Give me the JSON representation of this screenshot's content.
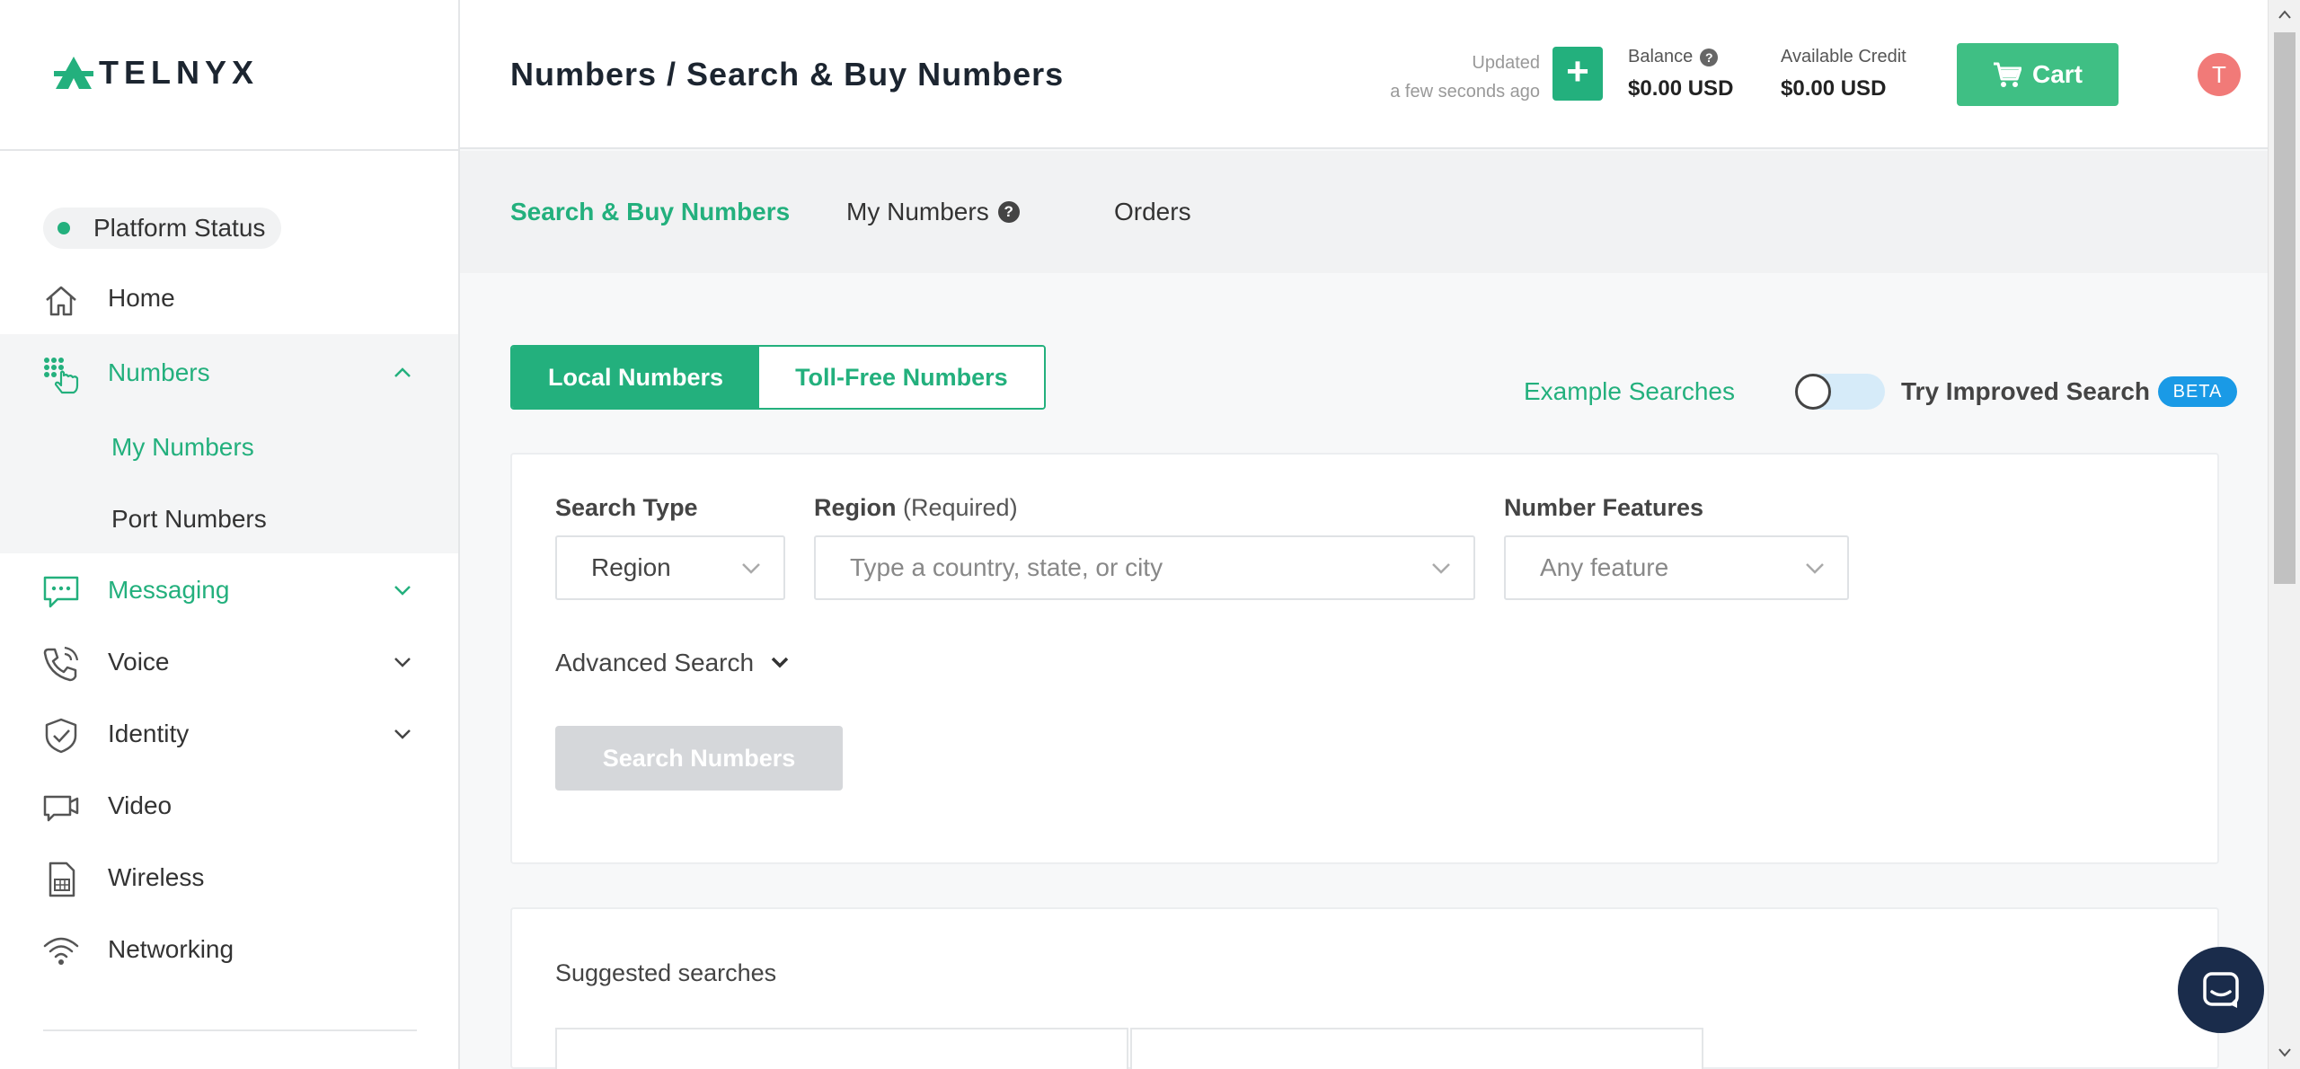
{
  "brand": {
    "name": "TELNYX",
    "accent": "#23b07d"
  },
  "header": {
    "title": "Numbers / Search & Buy Numbers",
    "updated_label": "Updated",
    "updated_time": "a few seconds ago",
    "balance_label": "Balance",
    "balance_value": "$0.00 USD",
    "credit_label": "Available Credit",
    "credit_value": "$0.00 USD",
    "cart_label": "Cart",
    "avatar_initial": "T"
  },
  "sidebar": {
    "platform_status": "Platform Status",
    "items": [
      {
        "label": "Home",
        "icon": "home-icon"
      },
      {
        "label": "Numbers",
        "icon": "numbers-icon",
        "expanded": true
      },
      {
        "label": "Messaging",
        "icon": "messaging-icon"
      },
      {
        "label": "Voice",
        "icon": "voice-icon"
      },
      {
        "label": "Identity",
        "icon": "identity-icon"
      },
      {
        "label": "Video",
        "icon": "video-icon"
      },
      {
        "label": "Wireless",
        "icon": "wireless-icon"
      },
      {
        "label": "Networking",
        "icon": "networking-icon"
      }
    ],
    "numbers_sub": [
      {
        "label": "My Numbers",
        "active": true
      },
      {
        "label": "Port Numbers",
        "active": false
      }
    ]
  },
  "tabs": [
    {
      "label": "Search & Buy Numbers",
      "active": true
    },
    {
      "label": "My Numbers",
      "active": false
    },
    {
      "label": "Orders",
      "active": false
    }
  ],
  "main": {
    "number_type_toggle": {
      "local": "Local Numbers",
      "tollfree": "Toll-Free Numbers",
      "selected": "Local Numbers"
    },
    "example_searches": "Example Searches",
    "improved_search_label": "Try Improved Search",
    "improved_search_on": false,
    "beta_badge": "BETA",
    "search_type_label": "Search Type",
    "search_type_value": "Region",
    "region_label": "Region",
    "region_required": "(Required)",
    "region_placeholder": "Type a country, state, or city",
    "features_label": "Number Features",
    "features_value": "Any feature",
    "advanced_search": "Advanced Search",
    "search_button": "Search Numbers",
    "suggested_title": "Suggested searches"
  }
}
